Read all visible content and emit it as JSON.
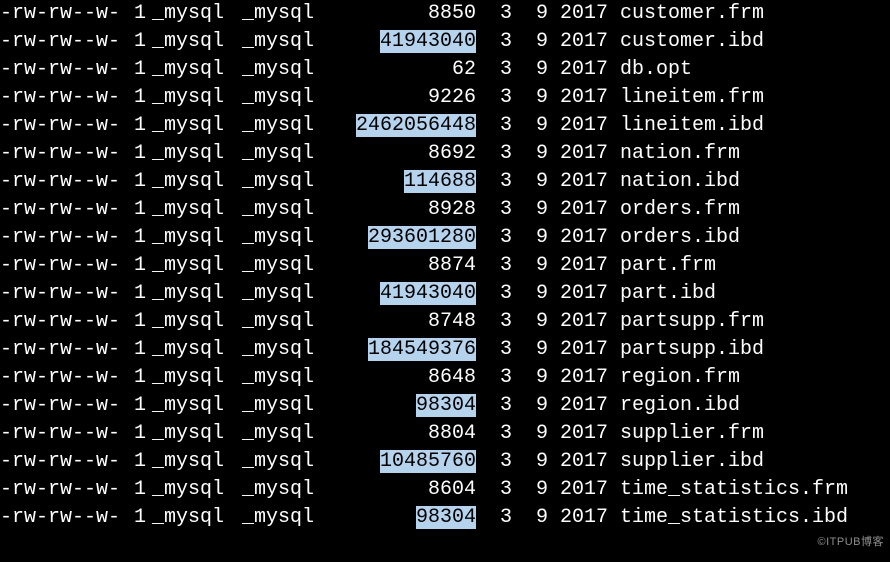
{
  "watermark": "©ITPUB博客",
  "listing": [
    {
      "perm": "-rw-rw--w-",
      "links": "1",
      "user": "_mysql",
      "group": "_mysql",
      "size": "8850",
      "hl": false,
      "mon": "3",
      "day": "9",
      "year": "2017",
      "name": "customer.frm"
    },
    {
      "perm": "-rw-rw--w-",
      "links": "1",
      "user": "_mysql",
      "group": "_mysql",
      "size": "41943040",
      "hl": true,
      "mon": "3",
      "day": "9",
      "year": "2017",
      "name": "customer.ibd"
    },
    {
      "perm": "-rw-rw--w-",
      "links": "1",
      "user": "_mysql",
      "group": "_mysql",
      "size": "62",
      "hl": false,
      "mon": "3",
      "day": "9",
      "year": "2017",
      "name": "db.opt"
    },
    {
      "perm": "-rw-rw--w-",
      "links": "1",
      "user": "_mysql",
      "group": "_mysql",
      "size": "9226",
      "hl": false,
      "mon": "3",
      "day": "9",
      "year": "2017",
      "name": "lineitem.frm"
    },
    {
      "perm": "-rw-rw--w-",
      "links": "1",
      "user": "_mysql",
      "group": "_mysql",
      "size": "2462056448",
      "hl": true,
      "mon": "3",
      "day": "9",
      "year": "2017",
      "name": "lineitem.ibd"
    },
    {
      "perm": "-rw-rw--w-",
      "links": "1",
      "user": "_mysql",
      "group": "_mysql",
      "size": "8692",
      "hl": false,
      "mon": "3",
      "day": "9",
      "year": "2017",
      "name": "nation.frm"
    },
    {
      "perm": "-rw-rw--w-",
      "links": "1",
      "user": "_mysql",
      "group": "_mysql",
      "size": "114688",
      "hl": true,
      "mon": "3",
      "day": "9",
      "year": "2017",
      "name": "nation.ibd"
    },
    {
      "perm": "-rw-rw--w-",
      "links": "1",
      "user": "_mysql",
      "group": "_mysql",
      "size": "8928",
      "hl": false,
      "mon": "3",
      "day": "9",
      "year": "2017",
      "name": "orders.frm"
    },
    {
      "perm": "-rw-rw--w-",
      "links": "1",
      "user": "_mysql",
      "group": "_mysql",
      "size": "293601280",
      "hl": true,
      "mon": "3",
      "day": "9",
      "year": "2017",
      "name": "orders.ibd"
    },
    {
      "perm": "-rw-rw--w-",
      "links": "1",
      "user": "_mysql",
      "group": "_mysql",
      "size": "8874",
      "hl": false,
      "mon": "3",
      "day": "9",
      "year": "2017",
      "name": "part.frm"
    },
    {
      "perm": "-rw-rw--w-",
      "links": "1",
      "user": "_mysql",
      "group": "_mysql",
      "size": "41943040",
      "hl": true,
      "mon": "3",
      "day": "9",
      "year": "2017",
      "name": "part.ibd"
    },
    {
      "perm": "-rw-rw--w-",
      "links": "1",
      "user": "_mysql",
      "group": "_mysql",
      "size": "8748",
      "hl": false,
      "mon": "3",
      "day": "9",
      "year": "2017",
      "name": "partsupp.frm"
    },
    {
      "perm": "-rw-rw--w-",
      "links": "1",
      "user": "_mysql",
      "group": "_mysql",
      "size": "184549376",
      "hl": true,
      "mon": "3",
      "day": "9",
      "year": "2017",
      "name": "partsupp.ibd"
    },
    {
      "perm": "-rw-rw--w-",
      "links": "1",
      "user": "_mysql",
      "group": "_mysql",
      "size": "8648",
      "hl": false,
      "mon": "3",
      "day": "9",
      "year": "2017",
      "name": "region.frm"
    },
    {
      "perm": "-rw-rw--w-",
      "links": "1",
      "user": "_mysql",
      "group": "_mysql",
      "size": "98304",
      "hl": true,
      "mon": "3",
      "day": "9",
      "year": "2017",
      "name": "region.ibd"
    },
    {
      "perm": "-rw-rw--w-",
      "links": "1",
      "user": "_mysql",
      "group": "_mysql",
      "size": "8804",
      "hl": false,
      "mon": "3",
      "day": "9",
      "year": "2017",
      "name": "supplier.frm"
    },
    {
      "perm": "-rw-rw--w-",
      "links": "1",
      "user": "_mysql",
      "group": "_mysql",
      "size": "10485760",
      "hl": true,
      "mon": "3",
      "day": "9",
      "year": "2017",
      "name": "supplier.ibd"
    },
    {
      "perm": "-rw-rw--w-",
      "links": "1",
      "user": "_mysql",
      "group": "_mysql",
      "size": "8604",
      "hl": false,
      "mon": "3",
      "day": "9",
      "year": "2017",
      "name": "time_statistics.frm"
    },
    {
      "perm": "-rw-rw--w-",
      "links": "1",
      "user": "_mysql",
      "group": "_mysql",
      "size": "98304",
      "hl": true,
      "mon": "3",
      "day": "9",
      "year": "2017",
      "name": "time_statistics.ibd"
    }
  ]
}
